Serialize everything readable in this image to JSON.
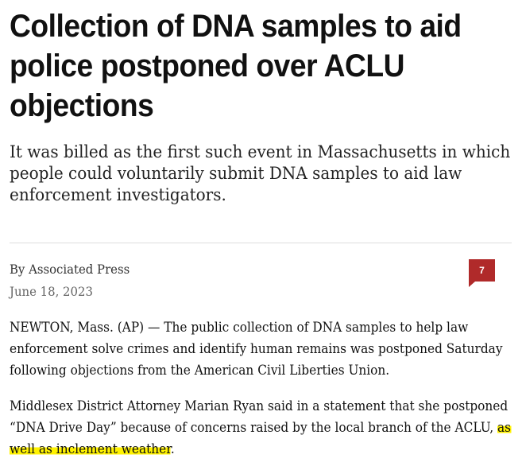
{
  "article": {
    "headline": "Collection of DNA samples to aid police postponed over ACLU objections",
    "subheadline": "It was billed as the first such event in Massachusetts in which people could voluntarily submit DNA samples to aid law enforcement investigators.",
    "byline": "By Associated Press",
    "date": "June 18, 2023",
    "comment_count": "7",
    "paragraphs": [
      "NEWTON, Mass. (AP) — The public collection of DNA samples to help law enforcement solve crimes and identify human remains was postponed Saturday following objections from the American Civil Liberties Union.",
      "Middlesex District Attorney Marian Ryan said in a statement that she postponed “DNA Drive Day” because of concerns raised by the local branch of the ACLU, "
    ],
    "highlighted_text": "as well as inclement weather",
    "paragraph_2_end": "."
  },
  "colors": {
    "badge": "#b02a2a",
    "highlight": "#fff200",
    "divider": "#dddddd"
  },
  "icons": {
    "comment": "comment-bubble-icon"
  }
}
